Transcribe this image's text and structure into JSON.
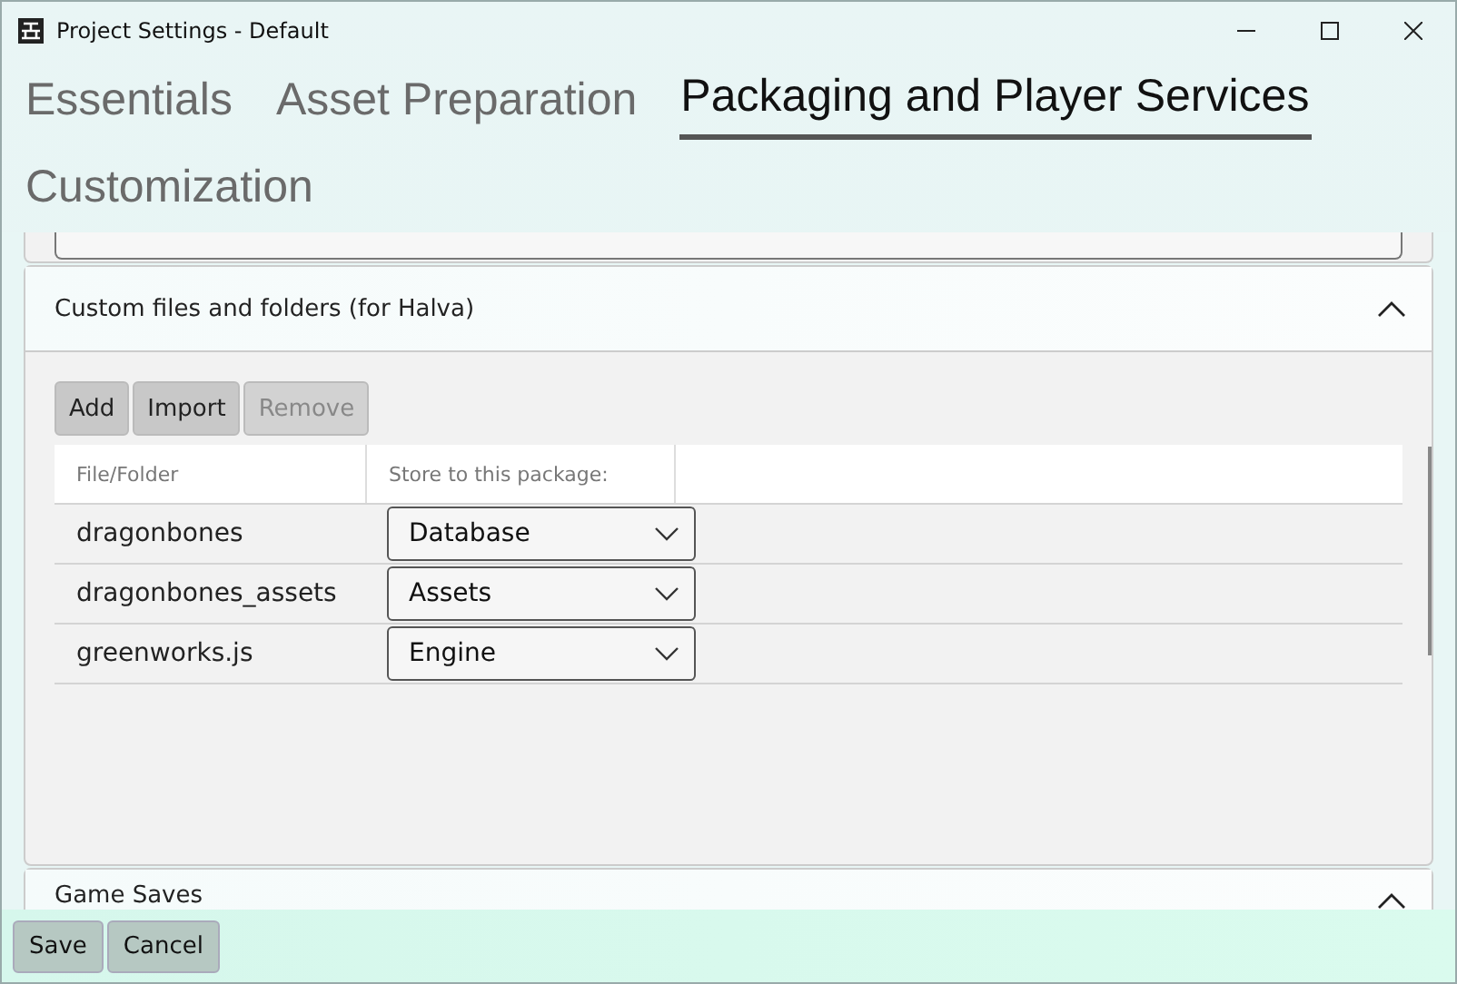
{
  "window": {
    "title": "Project Settings - Default"
  },
  "tabs": [
    {
      "label": "Essentials",
      "selected": false
    },
    {
      "label": "Asset Preparation",
      "selected": false
    },
    {
      "label": "Packaging and Player Services",
      "selected": true
    },
    {
      "label": "Customization",
      "selected": false
    }
  ],
  "sections": [
    {
      "title": "Custom files and folders (for Halva)",
      "expanded": true,
      "buttons": [
        {
          "label": "Add",
          "disabled": false
        },
        {
          "label": "Import",
          "disabled": false
        },
        {
          "label": "Remove",
          "disabled": true
        }
      ],
      "table": {
        "columns": [
          "File/Folder",
          "Store to this package:"
        ],
        "rows": [
          {
            "name": "dragonbones",
            "package": "Database"
          },
          {
            "name": "dragonbones_assets",
            "package": "Assets"
          },
          {
            "name": "greenworks.js",
            "package": "Engine"
          }
        ]
      }
    },
    {
      "title": "Game Saves",
      "expanded": true
    }
  ],
  "footer": {
    "buttons": [
      "Save",
      "Cancel"
    ]
  }
}
